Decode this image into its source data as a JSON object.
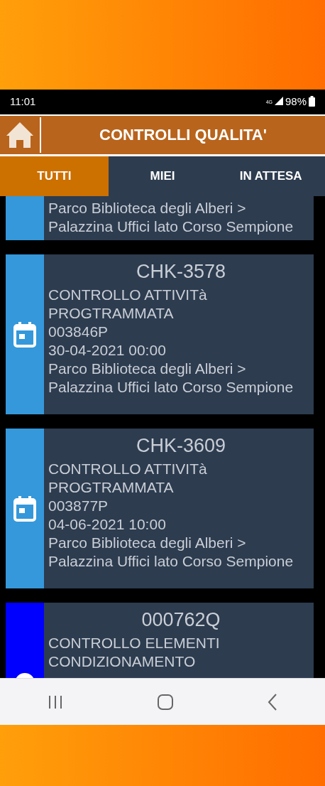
{
  "status_bar": {
    "time": "11:01",
    "network": "4G",
    "battery": "98%"
  },
  "header": {
    "title": "CONTROLLI QUALITA'"
  },
  "tabs": [
    {
      "label": "TUTTI",
      "selected": true
    },
    {
      "label": "MIEI",
      "selected": false
    },
    {
      "label": "IN ATTESA",
      "selected": false
    }
  ],
  "cards": [
    {
      "color": "#3498db",
      "address": "Parco Biblioteca degli Alberi > Palazzina Uffici lato Corso Sempione"
    },
    {
      "kind": "calendar",
      "color": "#3498db",
      "code": "CHK-3578",
      "description": "CONTROLLO ATTIVITà PROGTRAMMATA",
      "reference": "003846P",
      "date": "30-04-2021 00:00",
      "address": "Parco Biblioteca degli Alberi > Palazzina Uffici lato Corso Sempione"
    },
    {
      "kind": "calendar",
      "color": "#3498db",
      "code": "CHK-3609",
      "description": "CONTROLLO ATTIVITà PROGTRAMMATA",
      "reference": "003877P",
      "date": "04-06-2021 10:00",
      "address": "Parco Biblioteca degli Alberi > Palazzina Uffici lato Corso Sempione"
    },
    {
      "kind": "ring",
      "color": "#0000ff",
      "code": "000762Q",
      "description": "CONTROLLO ELEMENTI CONDIZIONAMENTO"
    }
  ]
}
